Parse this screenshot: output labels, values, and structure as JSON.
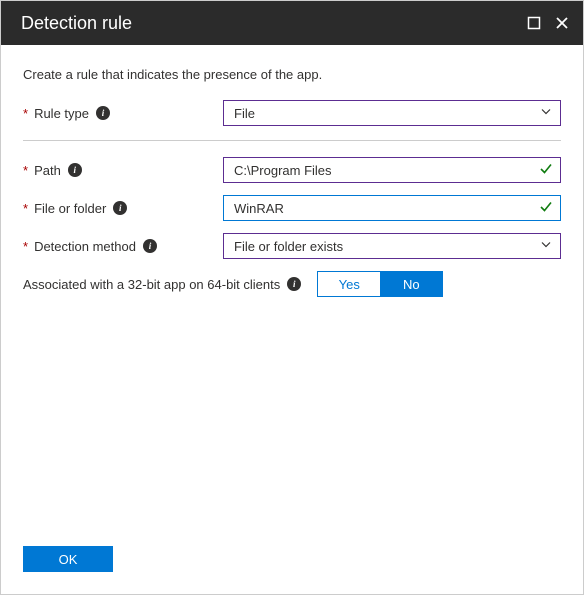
{
  "header": {
    "title": "Detection rule"
  },
  "description": "Create a rule that indicates the presence of the app.",
  "labels": {
    "rule_type": "Rule type",
    "path": "Path",
    "file_or_folder": "File or folder",
    "detection_method": "Detection method",
    "associated_32bit": "Associated with a 32-bit app on 64-bit clients"
  },
  "values": {
    "rule_type": "File",
    "path": "C:\\Program Files",
    "file_or_folder": "WinRAR",
    "detection_method": "File or folder exists"
  },
  "toggle": {
    "yes": "Yes",
    "no": "No",
    "selected": "no"
  },
  "buttons": {
    "ok": "OK"
  }
}
